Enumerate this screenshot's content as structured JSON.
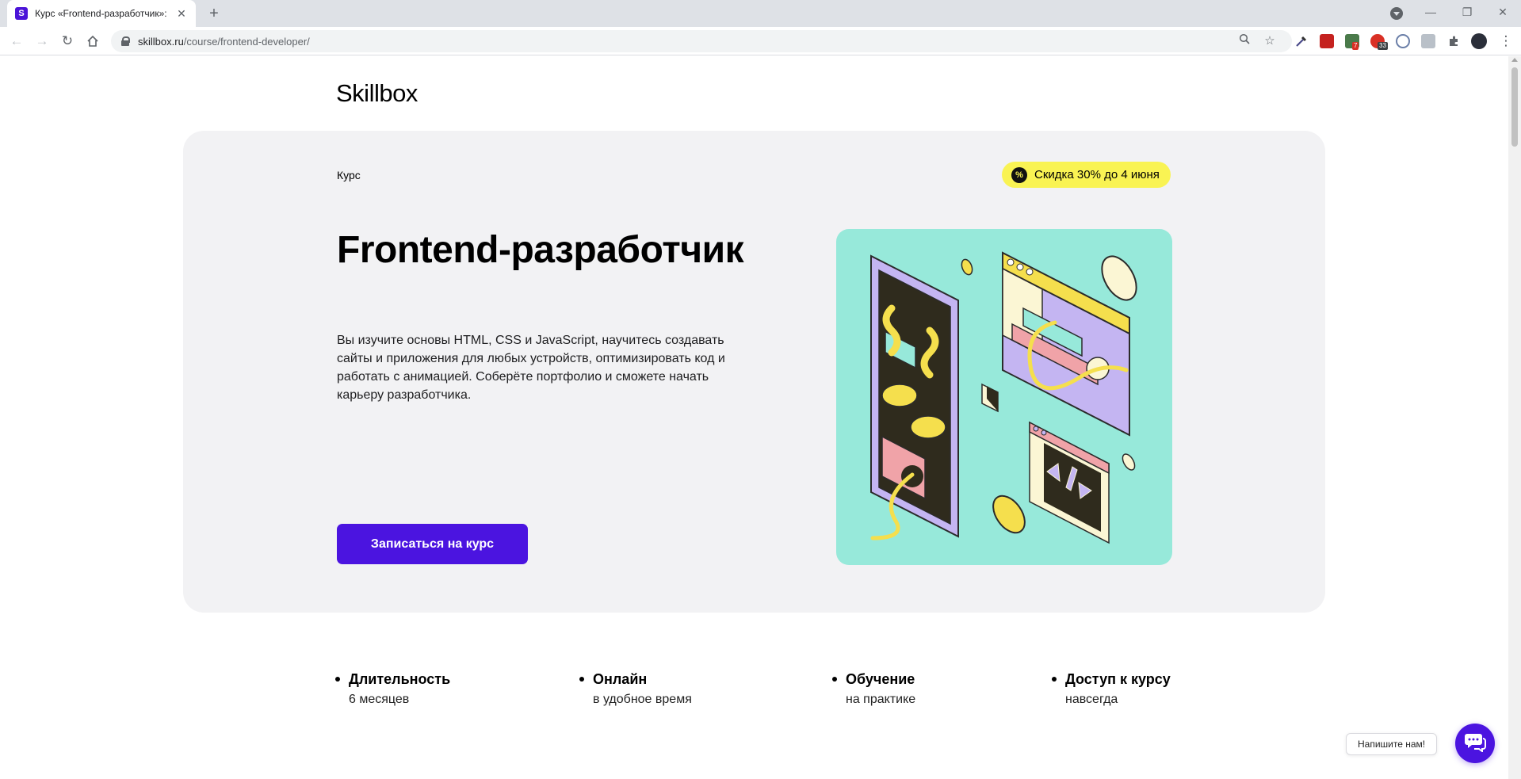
{
  "browser": {
    "tab_title": "Курс «Frontend-разработчик»: онлайн-обучение",
    "tab_favicon_letter": "S",
    "new_tab": "+",
    "url_host": "skillbox.ru",
    "url_path": "/course/frontend-developer/",
    "extension_badges": [
      "7",
      "33"
    ]
  },
  "site": {
    "logo": "Skillbox"
  },
  "hero": {
    "kicker": "Курс",
    "promo_icon": "%",
    "promo_text": "Скидка 30% до 4 июня",
    "title": "Frontend-разработчик",
    "description": "Вы изучите основы HTML, CSS и JavaScript, научитесь создавать сайты и приложения для любых устройств, оптимизировать код и работать с анимацией. Соберёте портфолио и сможете начать карьеру разработчика.",
    "cta_label": "Записаться на курс"
  },
  "features": [
    {
      "title": "Длительность",
      "subtitle": "6 месяцев"
    },
    {
      "title": "Онлайн",
      "subtitle": "в удобное время"
    },
    {
      "title": "Обучение",
      "subtitle": "на практике"
    },
    {
      "title": "Доступ к курсу",
      "subtitle": "навсегда"
    }
  ],
  "chat": {
    "label": "Напишите нам!"
  },
  "colors": {
    "brand": "#4b14e0",
    "promo": "#f9f353",
    "hero_bg": "#f2f2f4",
    "illustration_bg": "#97e9da"
  },
  "icons": [
    "back-arrow-icon",
    "forward-arrow-icon",
    "reload-icon",
    "home-icon",
    "lock-icon",
    "zoom-icon",
    "star-icon",
    "extensions-icon",
    "chat-icon",
    "percent-icon"
  ]
}
